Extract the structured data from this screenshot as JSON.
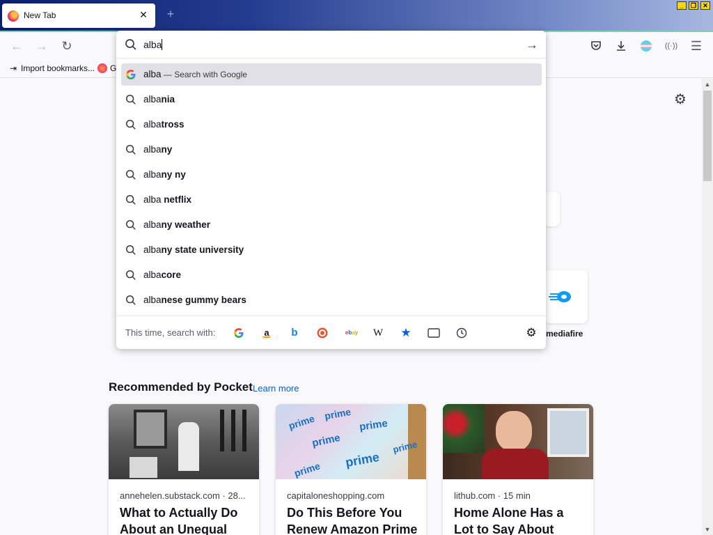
{
  "tab": {
    "title": "New Tab"
  },
  "window_controls": [
    "_",
    "❐",
    "✕"
  ],
  "address_bar": {
    "value": "alba"
  },
  "suggestions": [
    {
      "typed": "alba",
      "rest": "",
      "sub": "— Search with Google",
      "kind": "google",
      "highlighted": true
    },
    {
      "typed": "alba",
      "rest": "nia",
      "kind": "search"
    },
    {
      "typed": "alba",
      "rest": "tross",
      "kind": "search"
    },
    {
      "typed": "alba",
      "rest": "ny",
      "kind": "search"
    },
    {
      "typed": "alba",
      "rest": "ny ny",
      "kind": "search"
    },
    {
      "typed": "alba",
      "rest": " netflix",
      "kind": "search"
    },
    {
      "typed": "alba",
      "rest": "ny weather",
      "kind": "search"
    },
    {
      "typed": "alba",
      "rest": "ny state university",
      "kind": "search"
    },
    {
      "typed": "alba",
      "rest": "core",
      "kind": "search"
    },
    {
      "typed": "alba",
      "rest": "nese gummy bears",
      "kind": "search"
    }
  ],
  "one_off": {
    "label": "This time, search with:",
    "engines": [
      "google",
      "amazon",
      "bing",
      "duckduckgo",
      "ebay",
      "wikipedia",
      "bookmarks",
      "tabs",
      "history"
    ]
  },
  "bookmarks_bar": {
    "import_label": "Import bookmarks...",
    "second_label": "Ge"
  },
  "top_sites": {
    "visible_label": "mediafire"
  },
  "pocket": {
    "heading": "Recommended by Pocket",
    "learn_more": "Learn more",
    "cards": [
      {
        "source": "annehelen.substack.com · 28...",
        "title": "What to Actually Do About an Unequal"
      },
      {
        "source": "capitaloneshopping.com",
        "title": "Do This Before You Renew Amazon Prime"
      },
      {
        "source": "lithub.com · 15 min",
        "title": "Home Alone Has a Lot to Say About"
      }
    ]
  },
  "colors": {
    "accent": "#0060df",
    "highlight": "#e0e0e6",
    "titlebar": "#243c8f"
  }
}
